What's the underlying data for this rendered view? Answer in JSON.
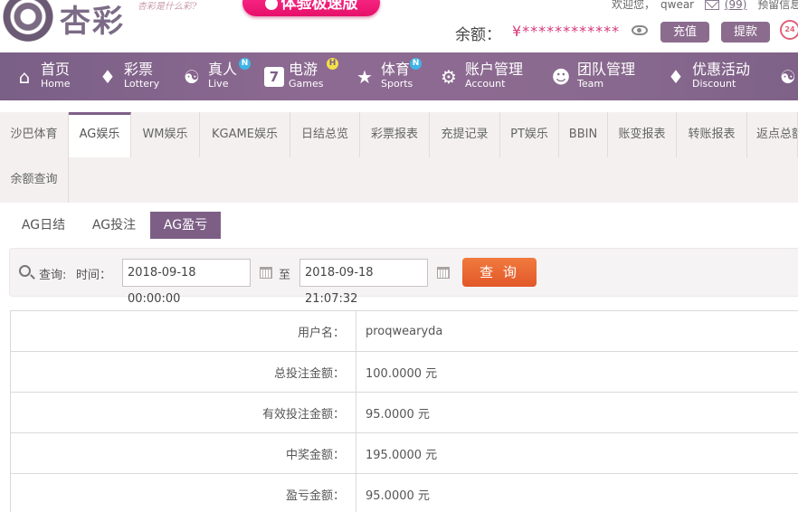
{
  "header": {
    "logo_text": "杏彩",
    "slogan": "杏彩是什么彩?",
    "promo_button": "体验极速版",
    "welcome_prefix": "欢迎您，",
    "username": "qwear",
    "message_count": "(99)",
    "notice_label": "预留信息",
    "support_badge": "24",
    "balance_label": "余额：",
    "balance_value": "¥************",
    "recharge_button": "充值",
    "withdraw_button": "提款"
  },
  "nav": {
    "items": [
      {
        "cn": "首页",
        "en": "Home",
        "icon": "home-icon"
      },
      {
        "cn": "彩票",
        "en": "Lottery",
        "icon": "lottery-icon"
      },
      {
        "cn": "真人",
        "en": "Live",
        "icon": "live-icon",
        "badge": "N"
      },
      {
        "cn": "电游",
        "en": "Games",
        "icon": "games-icon",
        "badge": "H"
      },
      {
        "cn": "体育",
        "en": "Sports",
        "icon": "trophy-icon",
        "badge": "N"
      },
      {
        "cn": "账户管理",
        "en": "Account",
        "icon": "account-icon"
      },
      {
        "cn": "团队管理",
        "en": "Team",
        "icon": "team-icon"
      },
      {
        "cn": "优惠活动",
        "en": "Discount",
        "icon": "gift-icon"
      }
    ]
  },
  "subtabs": [
    "沙巴体育",
    "AG娱乐",
    "WM娱乐",
    "KGAME娱乐",
    "日结总览",
    "彩票报表",
    "充提记录",
    "PT娱乐",
    "BBIN",
    "账变报表",
    "转账报表",
    "返点总额",
    "余额查询"
  ],
  "active_subtab": "AG娱乐",
  "ag_tabs": [
    "AG日结",
    "AG投注",
    "AG盈亏"
  ],
  "active_ag_tab": "AG盈亏",
  "query": {
    "label": "查询:",
    "time_label": "时间：",
    "start": "2018-09-18 00:00:00",
    "to": "至",
    "end": "2018-09-18 21:07:32",
    "button": "查 询"
  },
  "result": {
    "rows": [
      {
        "label": "用户名：",
        "value": "proqwearyda"
      },
      {
        "label": "总投注金额：",
        "value": "100.0000 元"
      },
      {
        "label": "有效投注金额：",
        "value": "95.0000 元"
      },
      {
        "label": "中奖金额：",
        "value": "195.0000 元"
      },
      {
        "label": "盈亏金额：",
        "value": "95.0000 元"
      }
    ]
  },
  "colors": {
    "brand_purple": "#7d5f86",
    "accent_pink": "#e6106a",
    "query_orange": "#e86a32"
  }
}
